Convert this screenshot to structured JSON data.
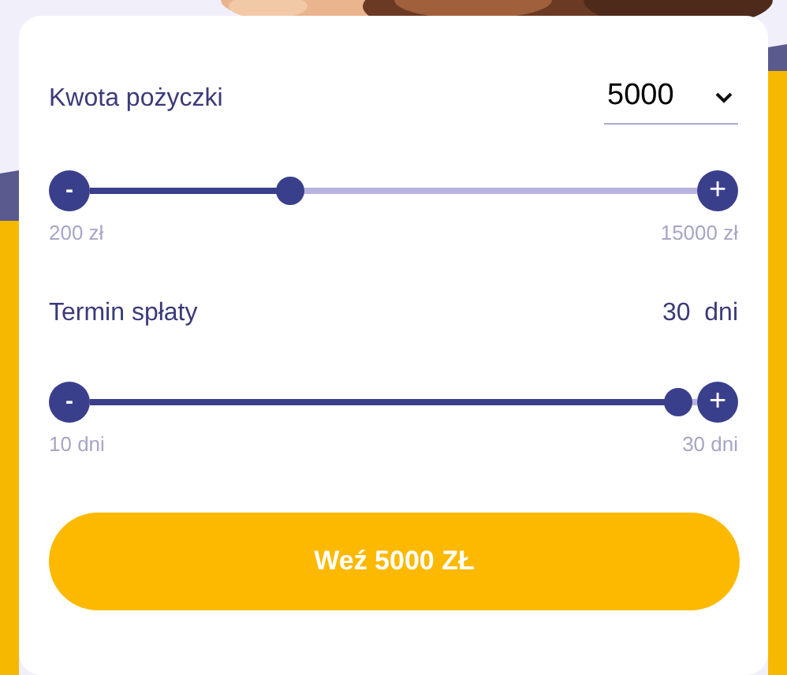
{
  "loan_amount": {
    "label": "Kwota pożyczki",
    "value": "5000",
    "slider": {
      "level": 0.33,
      "minus": "-",
      "plus": "+",
      "min_label": "200 zł",
      "max_label": "15000 zł"
    }
  },
  "term": {
    "label": "Termin spłaty",
    "value": "30",
    "unit": "dni",
    "slider": {
      "level": 0.97,
      "minus": "-",
      "plus": "+",
      "min_label": "10 dni",
      "max_label": "30 dni"
    }
  },
  "submit_button": {
    "label": "Weź 5000 ZŁ"
  }
}
